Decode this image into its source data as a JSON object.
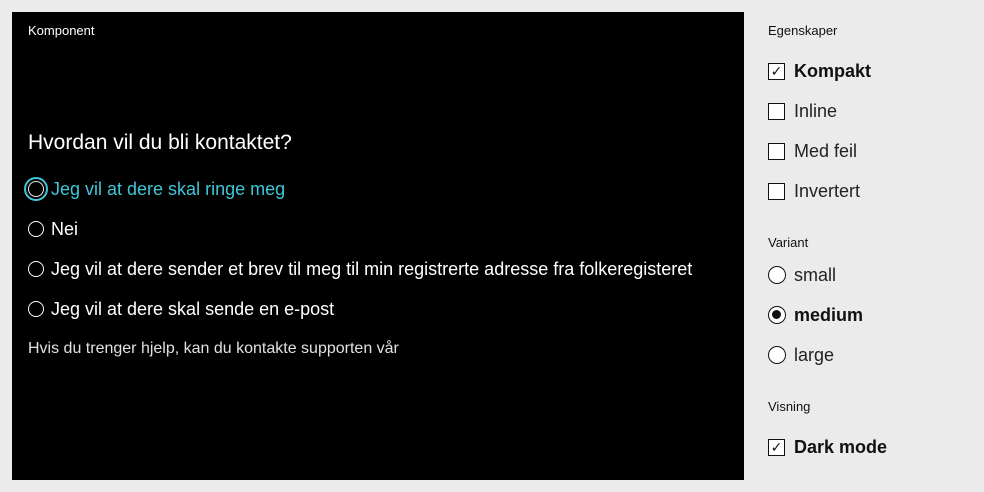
{
  "preview": {
    "label": "Komponent",
    "legend": "Hvordan vil du bli kontaktet?",
    "options": [
      {
        "label": "Jeg vil at dere skal ringe meg",
        "focused": true
      },
      {
        "label": "Nei",
        "focused": false
      },
      {
        "label": "Jeg vil at dere sender et brev til meg til min registrerte adresse fra folkeregisteret",
        "focused": false
      },
      {
        "label": "Jeg vil at dere skal sende en e-post",
        "focused": false
      }
    ],
    "help_text": "Hvis du trenger hjelp, kan du kontakte supporten vår",
    "focus_color": "#3fc6d9"
  },
  "panel": {
    "properties": {
      "label": "Egenskaper",
      "items": [
        {
          "label": "Kompakt",
          "checked": true
        },
        {
          "label": "Inline",
          "checked": false
        },
        {
          "label": "Med feil",
          "checked": false
        },
        {
          "label": "Invertert",
          "checked": false
        }
      ]
    },
    "variant": {
      "label": "Variant",
      "options": [
        {
          "label": "small",
          "selected": false
        },
        {
          "label": "medium",
          "selected": true
        },
        {
          "label": "large",
          "selected": false
        }
      ]
    },
    "view": {
      "label": "Visning",
      "items": [
        {
          "label": "Dark mode",
          "checked": true
        }
      ]
    }
  }
}
